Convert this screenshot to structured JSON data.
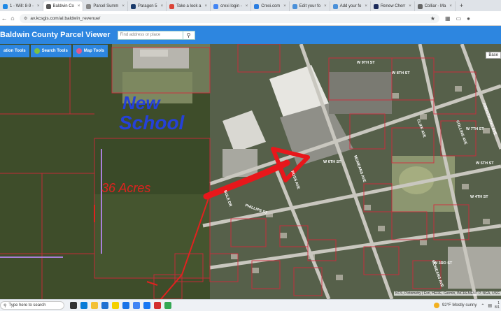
{
  "browser": {
    "tabs": [
      {
        "label": "1 - Will: 8-9 -",
        "color": "#1e88e5"
      },
      {
        "label": "Baldwin Co",
        "color": "#555555",
        "active": true
      },
      {
        "label": "Parcel Summ",
        "color": "#888888"
      },
      {
        "label": "Paragon 5",
        "color": "#1a3a6b"
      },
      {
        "label": "Take a look a",
        "color": "#db4437"
      },
      {
        "label": "crexi login -",
        "color": "#4285f4"
      },
      {
        "label": "Crexi.com",
        "color": "#2a7de1"
      },
      {
        "label": "Edit your fo",
        "color": "#4a90d9"
      },
      {
        "label": "Add your fo",
        "color": "#4a90d9"
      },
      {
        "label": "Renew Cherr",
        "color": "#1b2a5a"
      },
      {
        "label": "Colliar - Ma",
        "color": "#666666"
      }
    ],
    "url": "av.kcsgis.com/al.baldwin_revenue/"
  },
  "app": {
    "title": "Baldwin County Parcel Viewer",
    "search_placeholder": "Find address or place",
    "tools": [
      {
        "label": "ation Tools",
        "icon": "layers-icon"
      },
      {
        "label": "Search Tools",
        "icon": "search-icon"
      },
      {
        "label": "Map Tools",
        "icon": "map-icon"
      }
    ],
    "basemap_label": "Base"
  },
  "map": {
    "annotations": {
      "new_school": [
        "New",
        "School"
      ],
      "acres": "36 Acres"
    },
    "streets": [
      "W 9TH ST",
      "W 8TH ST",
      "W 7TH ST",
      "W 6TH ST",
      "W 5TH ST",
      "W 4TH ST",
      "W 3RD ST",
      "MCMEANS AVE",
      "CLIFF AVE",
      "COLLINS AVE",
      "ARMSTRONG AVE",
      "PHILLIPS ST",
      "ROSS AVE",
      "BULE DR",
      "MCMEANS AVE"
    ],
    "attribution": "KCS, Pictometry | Esri, HERE, Garmin, INCREMENT P, NGA, USG"
  },
  "taskbar": {
    "search_placeholder": "Type here to search",
    "weather": "92°F  Mostly sunny",
    "time": "1",
    "date": "8/1"
  }
}
